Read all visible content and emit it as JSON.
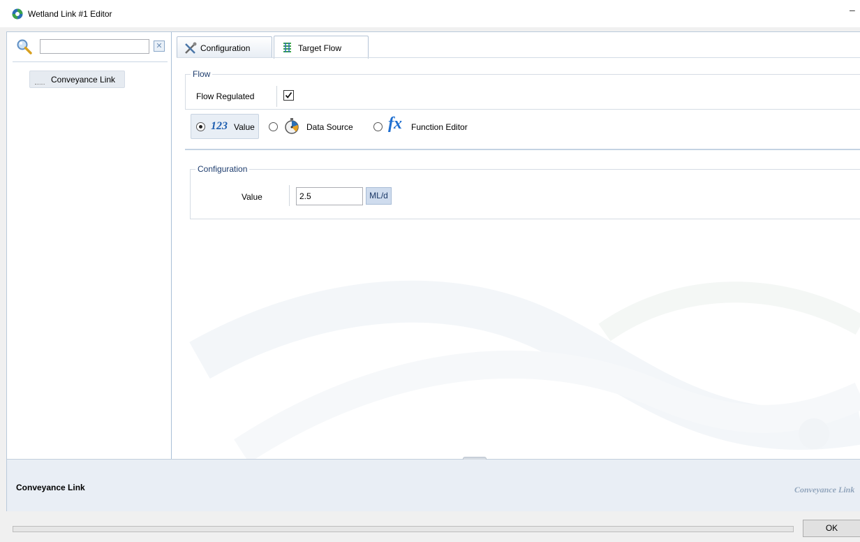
{
  "window": {
    "title": "Wetland Link #1 Editor",
    "minimize_glyph": "–"
  },
  "sidebar": {
    "search_value": "",
    "clear_glyph": "✕",
    "tree_items": [
      {
        "label": "Conveyance Link"
      }
    ]
  },
  "tabs": [
    {
      "label": "Configuration",
      "icon": "tools-icon",
      "active": false
    },
    {
      "label": "Target Flow",
      "icon": "flow-icon",
      "active": true
    }
  ],
  "flow_group": {
    "legend": "Flow",
    "flow_regulated_label": "Flow Regulated",
    "flow_regulated_checked": true
  },
  "value_mode": {
    "selected": "value",
    "options": [
      {
        "key": "value",
        "icon_text": "123",
        "label": "Value"
      },
      {
        "key": "data_source",
        "icon": "stopwatch-icon",
        "label": "Data Source"
      },
      {
        "key": "function_editor",
        "icon_text": "fx",
        "label": "Function Editor"
      }
    ]
  },
  "config_group": {
    "legend": "Configuration",
    "value_label": "Value",
    "value": "2.5",
    "unit": "ML/d"
  },
  "bottom": {
    "title": "Conveyance Link",
    "watermark": "Conveyance Link"
  },
  "footer": {
    "ok_label": "OK"
  },
  "colors": {
    "accent": "#1e3d6e",
    "panel_bg": "#e9eef5",
    "border": "#b9c9da"
  }
}
